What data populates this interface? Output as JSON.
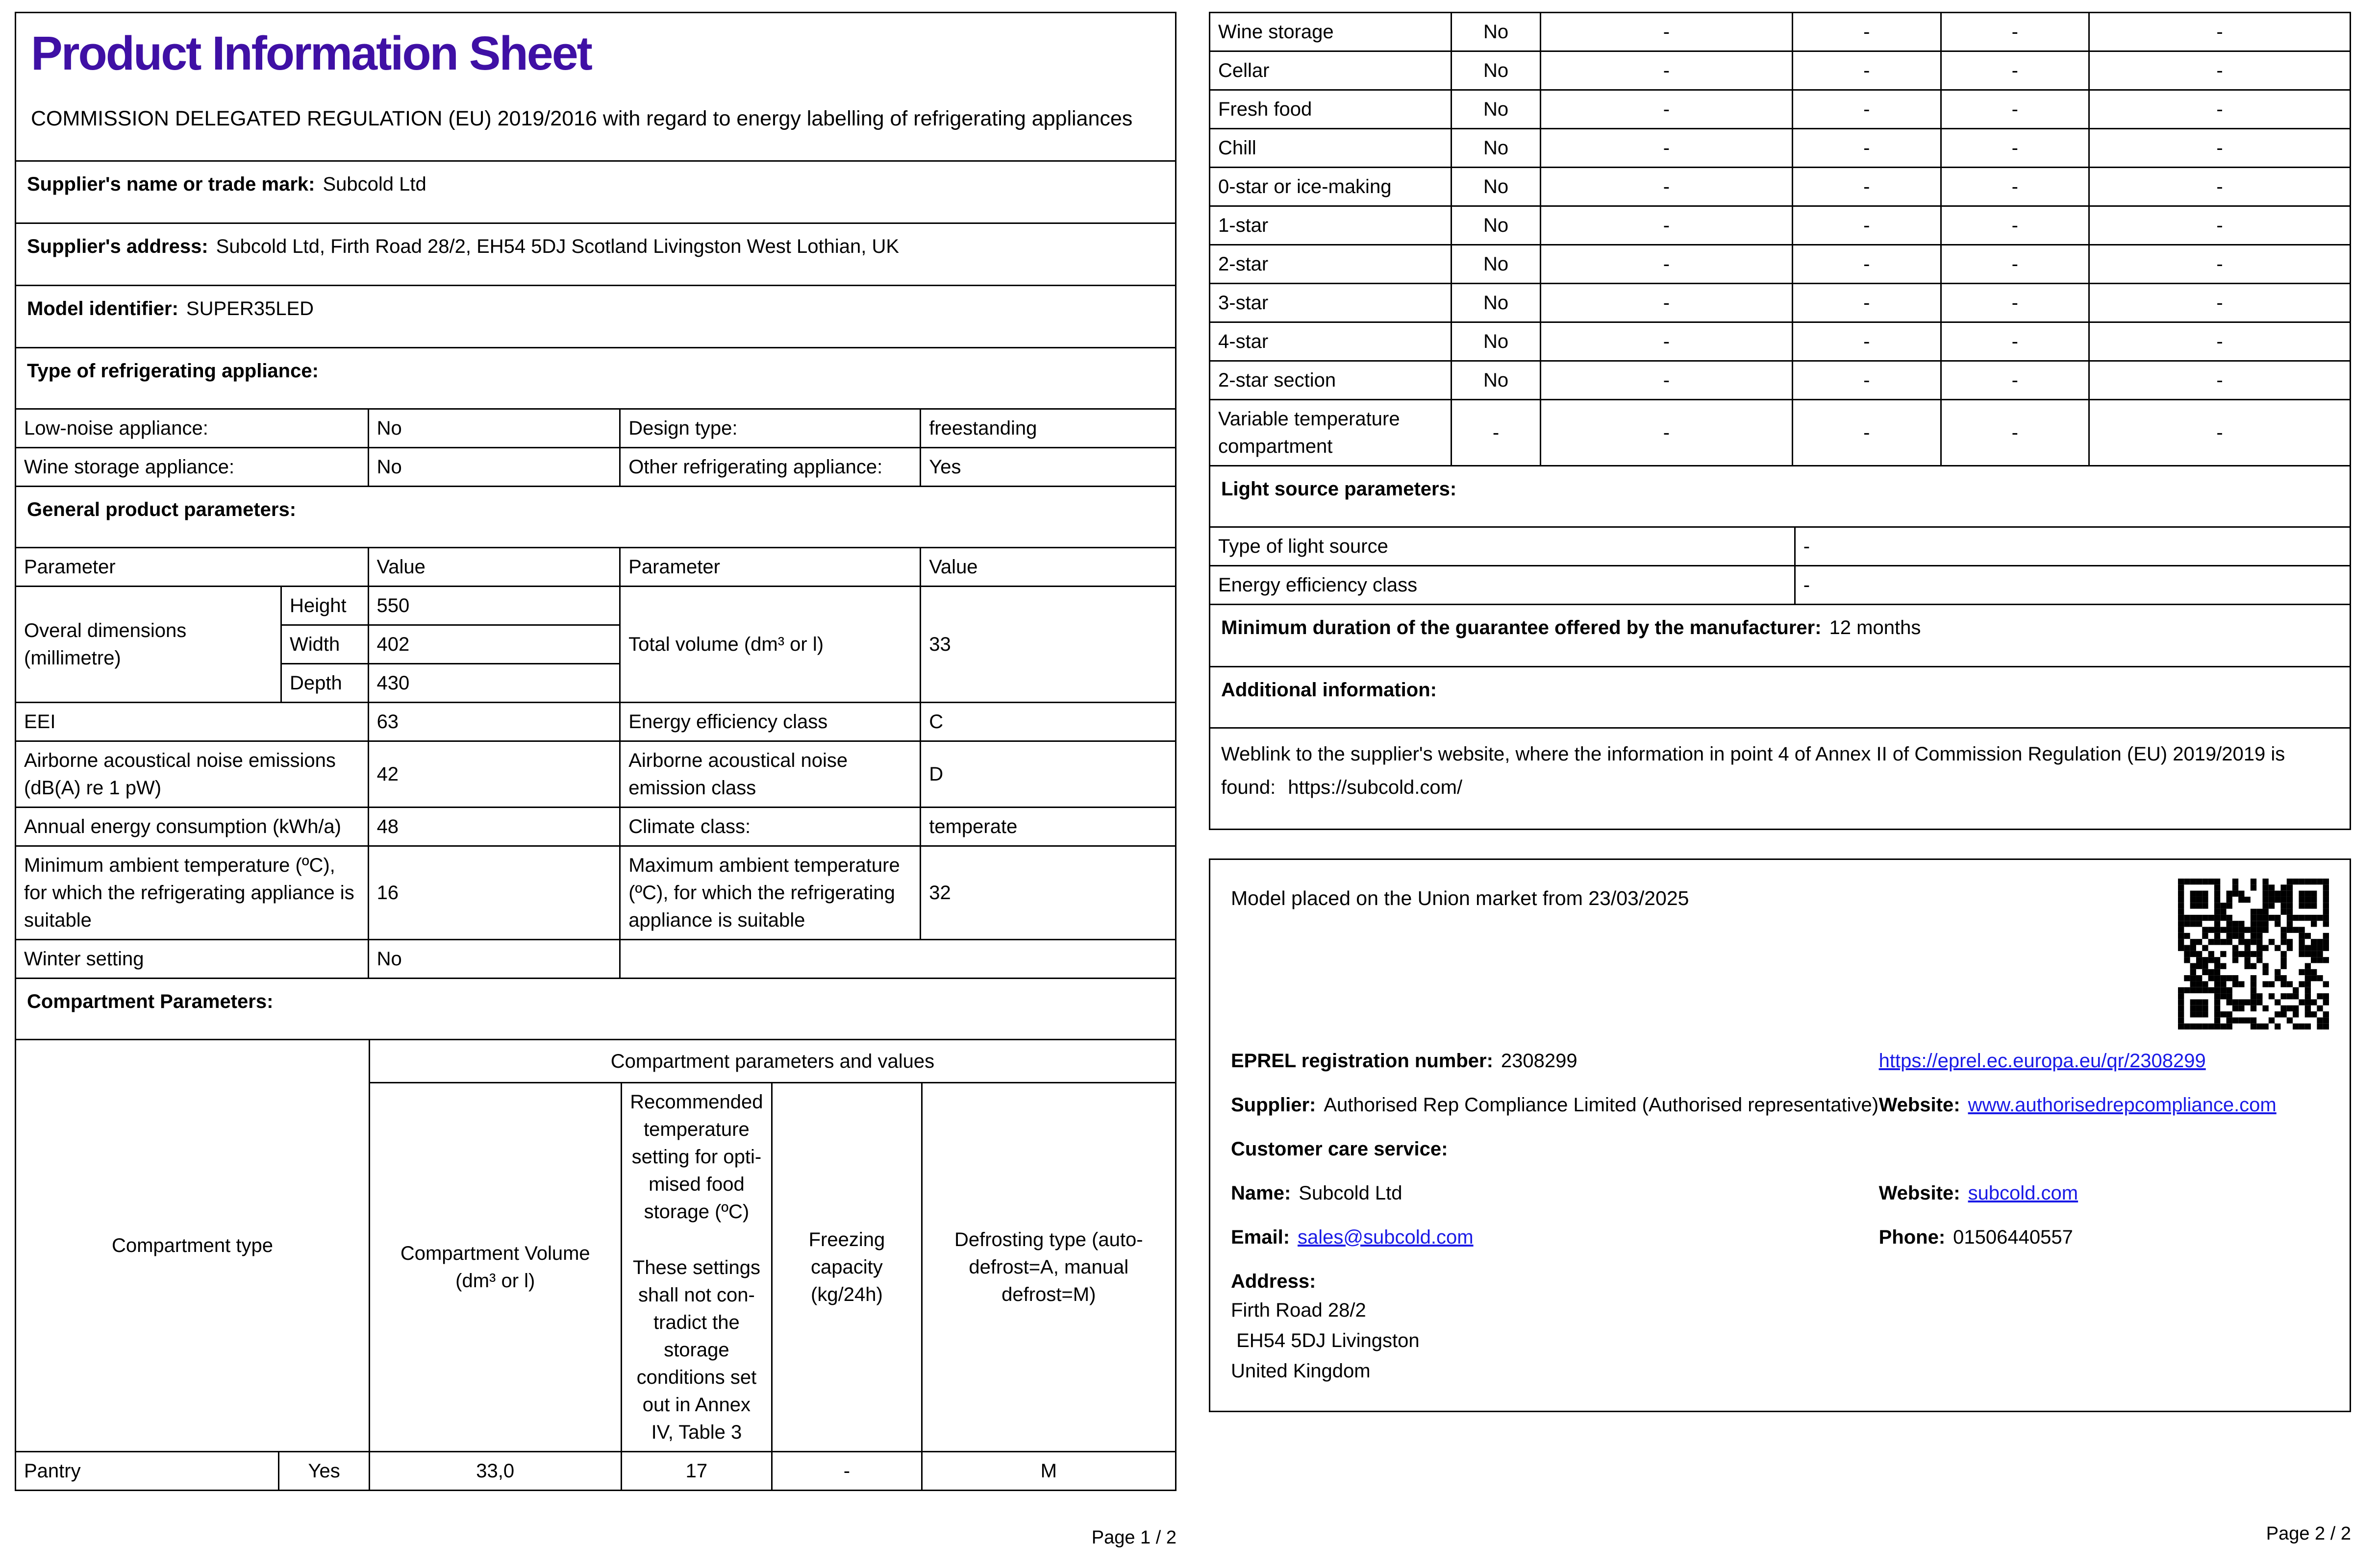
{
  "colors": {
    "title_purple": "#3f10a5",
    "link_blue": "#1a1ae6"
  },
  "page1": {
    "title": "Product Information Sheet",
    "regulation": "COMMISSION DELEGATED REGULATION (EU) 2019/2016 with regard to energy labelling of refrigerating appliances",
    "supplier_name": {
      "label": "Supplier's name or trade mark:",
      "value": "Subcold Ltd"
    },
    "supplier_address": {
      "label": "Supplier's address:",
      "value": "Subcold Ltd, Firth Road 28/2, EH54 5DJ Scotland Livingston West Lothian, UK"
    },
    "model": {
      "label": "Model identifier:",
      "value": "SUPER35LED"
    },
    "type_heading": "Type of refrigerating appliance:",
    "type_rows": [
      {
        "p1": "Low-noise appliance:",
        "v1": "No",
        "p2": "Design type:",
        "v2": "freestanding"
      },
      {
        "p1": "Wine storage appliance:",
        "v1": "No",
        "p2": "Other refrigerating appli­ance:",
        "v2": "Yes"
      }
    ],
    "general_heading": "General product parameters:",
    "general": {
      "headers": [
        "Parameter",
        "Value",
        "Parameter",
        "Value"
      ],
      "dimensions": {
        "label": "Overal dimensions (millimetre)",
        "rows": [
          {
            "k": "Height",
            "v": "550"
          },
          {
            "k": "Width",
            "v": "402"
          },
          {
            "k": "Depth",
            "v": "430"
          }
        ],
        "right_label": "Total volume (dm³ or l)",
        "right_value": "33"
      },
      "rows": [
        {
          "p1": "EEI",
          "v1": "63",
          "p2": "Energy efficiency class",
          "v2": "C"
        },
        {
          "p1": "Airborne acoustical noise emis­sions (dB(A) re 1 pW)",
          "v1": "42",
          "p2": "Airborne acoustical noise emission class",
          "v2": "D"
        },
        {
          "p1": "Annual energy consumption (kWh/a)",
          "v1": "48",
          "p2": "Climate class:",
          "v2": "temperate"
        },
        {
          "p1": "Minimum ambient tempera­ture (ºC), for which the refrig­erating appliance is suitable",
          "v1": "16",
          "p2": "Maximum ambient tem­perature (ºC), for which the refrigerating appliance is suitable",
          "v2": "32"
        }
      ],
      "winter": {
        "label": "Winter setting",
        "value": "No"
      }
    },
    "compartment_heading": "Compartment Parameters:",
    "comp_table": {
      "span_header": "Compartment parameters and values",
      "col_type": "Compartment type",
      "col_volume": "Compartment Vol­ume (dm³ or l)",
      "col_temp_a": "Recom­mended tempera­ture setting for opti­mised food storage (ºC)",
      "col_temp_b": "These set­tings shall not con­tradict the storage conditions set out in Annex IV, Table 3",
      "col_freeze": "Freezing capacity (kg/24h)",
      "col_defrost": "Defrosting type (auto-defrost=A, manual defrost=M)",
      "row": {
        "name": "Pantry",
        "present": "Yes",
        "volume": "33,0",
        "temp": "17",
        "freeze": "-",
        "defrost": "M"
      }
    },
    "page_label": "Page 1 / 2"
  },
  "page2": {
    "compartments": [
      {
        "name": "Wine storage",
        "values": [
          "No",
          "-",
          "-",
          "-",
          "-"
        ]
      },
      {
        "name": "Cellar",
        "values": [
          "No",
          "-",
          "-",
          "-",
          "-"
        ]
      },
      {
        "name": "Fresh food",
        "values": [
          "No",
          "-",
          "-",
          "-",
          "-"
        ]
      },
      {
        "name": "Chill",
        "values": [
          "No",
          "-",
          "-",
          "-",
          "-"
        ]
      },
      {
        "name": "0-star or ice-making",
        "values": [
          "No",
          "-",
          "-",
          "-",
          "-"
        ]
      },
      {
        "name": "1-star",
        "values": [
          "No",
          "-",
          "-",
          "-",
          "-"
        ]
      },
      {
        "name": "2-star",
        "values": [
          "No",
          "-",
          "-",
          "-",
          "-"
        ]
      },
      {
        "name": "3-star",
        "values": [
          "No",
          "-",
          "-",
          "-",
          "-"
        ]
      },
      {
        "name": "4-star",
        "values": [
          "No",
          "-",
          "-",
          "-",
          "-"
        ]
      },
      {
        "name": "2-star section",
        "values": [
          "No",
          "-",
          "-",
          "-",
          "-"
        ]
      },
      {
        "name": "Variable temperature compartment",
        "values": [
          "-",
          "-",
          "-",
          "-",
          "-"
        ]
      }
    ],
    "light_heading": "Light source parameters:",
    "light_rows": [
      {
        "label": "Type of light source",
        "value": "-"
      },
      {
        "label": "Energy efficiency class",
        "value": "-"
      }
    ],
    "guarantee": {
      "label": "Minimum duration of the guarantee offered by the manufacturer:",
      "value": "12 months"
    },
    "additional_heading": "Additional information:",
    "weblink": {
      "text": "Weblink to the supplier's website, where the information in point 4 of Annex II of Commission Regulation (EU) 2019/2019 is found:",
      "url": "https://subcold.com/"
    },
    "box": {
      "market": "Model placed on the Union market from 23/03/2025",
      "eprel": {
        "label": "EPREL registration number:",
        "value": "2308299",
        "link": "https://eprel.ec.europa.eu/qr/2308299"
      },
      "supplier": {
        "label": "Supplier:",
        "value": "Authorised Rep Compliance Limited (Authorised representative)"
      },
      "website1": {
        "label": "Website:",
        "link": "www.authorisedrepcompliance.com"
      },
      "customer_care": "Customer care service:",
      "name": {
        "label": "Name:",
        "value": "Subcold Ltd"
      },
      "website2": {
        "label": "Website:",
        "link": "subcold.com"
      },
      "email": {
        "label": "Email:",
        "link": "sales@subcold.com"
      },
      "phone": {
        "label": "Phone:",
        "value": "01506440557"
      },
      "address": {
        "label": "Address:",
        "lines": [
          "Firth Road 28/2",
          " EH54 5DJ Livingston",
          "United Kingdom"
        ]
      }
    },
    "page_label": "Page 2 / 2"
  }
}
